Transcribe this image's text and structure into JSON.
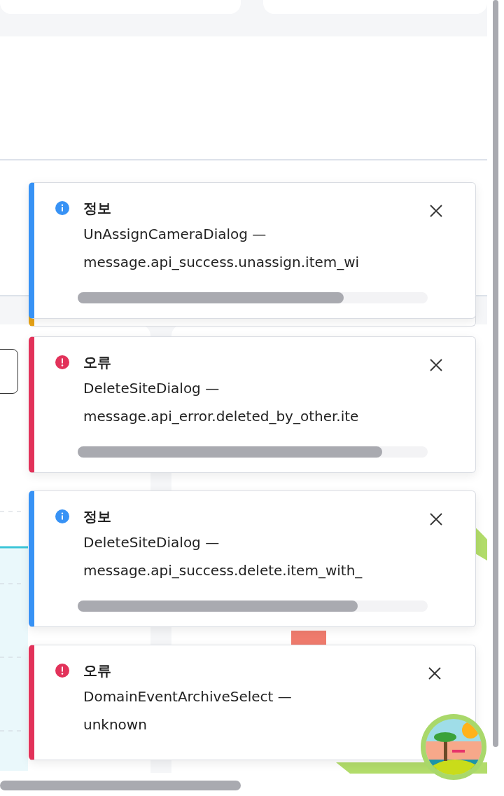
{
  "stacked_toast": {
    "kind": "warning"
  },
  "toasts": [
    {
      "kind": "info",
      "title": "정보",
      "source": "UnAssignCameraDialog —",
      "message": "message.api_success.unassign.item_wi",
      "level": 0.76
    },
    {
      "kind": "error",
      "title": "오류",
      "source": "DeleteSiteDialog —",
      "message": "message.api_error.deleted_by_other.ite",
      "level": 0.87
    },
    {
      "kind": "info",
      "title": "정보",
      "source": "DeleteSiteDialog —",
      "message": "message.api_success.delete.item_with_",
      "level": 0.8
    },
    {
      "kind": "error",
      "title": "오류",
      "source": "DomainEventArchiveSelect —",
      "message": "unknown"
    }
  ]
}
